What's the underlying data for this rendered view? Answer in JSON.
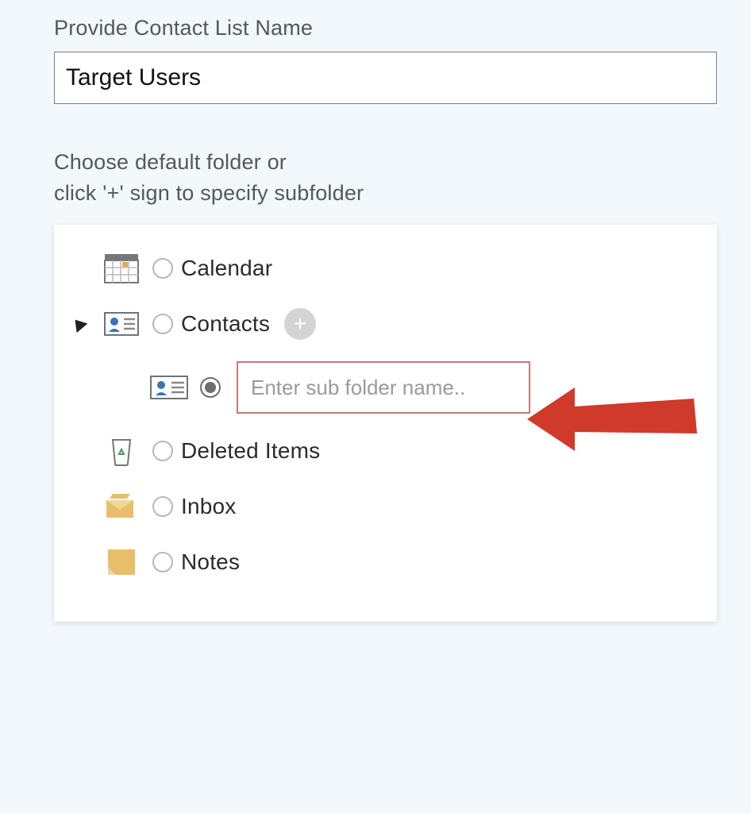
{
  "title_label": "Provide Contact List Name",
  "name_value": "Target Users",
  "instruction_line1": "Choose default folder or",
  "instruction_line2": "click '+' sign to specify subfolder",
  "folders": {
    "calendar": {
      "label": "Calendar",
      "selected": false
    },
    "contacts": {
      "label": "Contacts",
      "selected": false,
      "expanded": true
    },
    "deleted": {
      "label": "Deleted Items",
      "selected": false
    },
    "inbox": {
      "label": "Inbox",
      "selected": false
    },
    "notes": {
      "label": "Notes",
      "selected": false
    }
  },
  "subfolder": {
    "placeholder": "Enter sub folder name..",
    "value": "",
    "selected": true
  },
  "add_button_glyph": "+"
}
